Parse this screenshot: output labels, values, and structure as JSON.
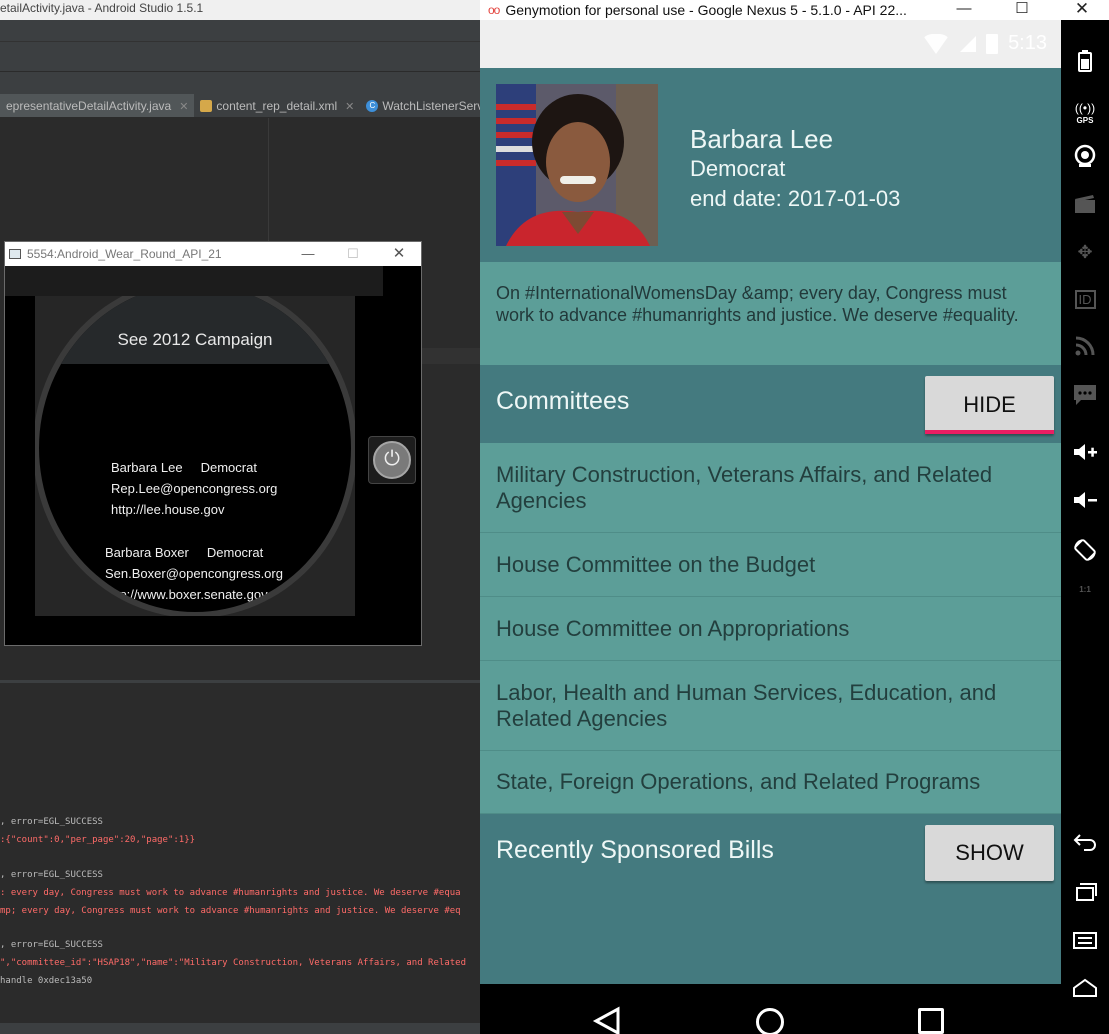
{
  "studio": {
    "title": "etailActivity.java - Android Studio 1.5.1",
    "tabs": [
      {
        "label": "epresentativeDetailActivity.java"
      },
      {
        "label": "content_rep_detail.xml"
      },
      {
        "label": "WatchListenerServ"
      }
    ],
    "log_lines": [
      {
        "text": ", error=EGL_SUCCESS",
        "color": "white"
      },
      {
        "text": ":{\"count\":0,\"per_page\":20,\"page\":1}}",
        "color": "red"
      },
      {
        "text": ", error=EGL_SUCCESS",
        "color": "white"
      },
      {
        "text": ": every day, Congress must work to advance #humanrights and justice. We deserve #equa",
        "color": "red"
      },
      {
        "text": "mp; every day, Congress must work to advance #humanrights and justice. We deserve #eq",
        "color": "red"
      },
      {
        "text": ", error=EGL_SUCCESS",
        "color": "white"
      },
      {
        "text": "\",\"committee_id\":\"HSAP18\",\"name\":\"Military Construction, Veterans Affairs, and Related",
        "color": "red"
      },
      {
        "text": " handle 0xdec13a50",
        "color": "white"
      }
    ]
  },
  "wear": {
    "window_title": "5554:Android_Wear_Round_API_21",
    "header": "See 2012 Campaign",
    "reps": [
      {
        "name_party": "Barbara Lee     Democrat",
        "email": "Rep.Lee@opencongress.org",
        "url": "http://lee.house.gov"
      },
      {
        "name_party": "Barbara Boxer     Democrat",
        "email": "Sen.Boxer@opencongress.org",
        "url": "http://www.boxer.senate.gov"
      }
    ]
  },
  "genymotion": {
    "window_title": "Genymotion for personal use - Google Nexus 5 - 5.1.0 - API 22...",
    "logo": "oo",
    "status_time": "5:13",
    "sidebar": [
      {
        "icon": "battery-icon",
        "label": ""
      },
      {
        "icon": "gps-icon",
        "label": "GPS"
      },
      {
        "icon": "camera-icon",
        "label": ""
      },
      {
        "icon": "video-icon",
        "label": ""
      },
      {
        "icon": "dpad-icon",
        "label": ""
      },
      {
        "icon": "id-icon",
        "label": "ID"
      },
      {
        "icon": "rss-icon",
        "label": ""
      },
      {
        "icon": "sms-icon",
        "label": ""
      },
      {
        "icon": "volume-up-icon",
        "label": ""
      },
      {
        "icon": "volume-down-icon",
        "label": ""
      },
      {
        "icon": "rotate-icon",
        "label": ""
      },
      {
        "icon": "pixel-perfect-icon",
        "label": "1:1"
      },
      {
        "icon": "back-icon",
        "label": ""
      },
      {
        "icon": "recent-apps-icon",
        "label": ""
      },
      {
        "icon": "menu-icon",
        "label": ""
      },
      {
        "icon": "home-icon",
        "label": ""
      }
    ]
  },
  "app": {
    "name": "Barbara Lee",
    "party": "Democrat",
    "end_date": "end date: 2017-01-03",
    "tweet": "On #InternationalWomensDay &amp; every day, Congress must work to advance #humanrights and justice. We deserve #equality.",
    "committees_title": "Committees",
    "hide_label": "HIDE",
    "committees": [
      "Military Construction, Veterans Affairs, and Related Agencies",
      "House Committee on the Budget",
      "House Committee on Appropriations",
      "Labor, Health and Human Services, Education, and Related Agencies",
      "State, Foreign Operations, and Related Programs"
    ],
    "bills_title": "Recently Sponsored Bills",
    "show_label": "SHOW"
  },
  "colors": {
    "header_teal": "#447a7f",
    "body_teal": "#5c9e98",
    "accent_pink": "#e91e63"
  }
}
